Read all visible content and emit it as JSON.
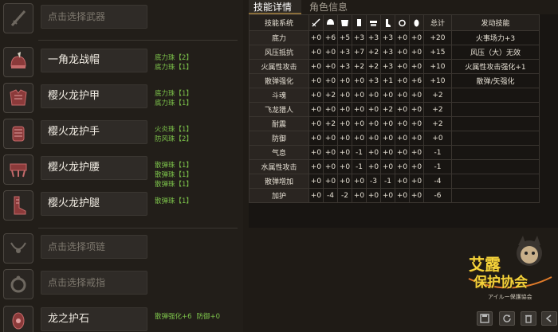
{
  "slots": [
    {
      "id": "weapon",
      "name": "点击选择武器",
      "empty": true,
      "jewels": []
    },
    {
      "id": "head",
      "name": "一角龙战帽",
      "empty": false,
      "jewels": [
        "底力珠【2】",
        "底力珠【1】"
      ]
    },
    {
      "id": "chest",
      "name": "樱火龙护甲",
      "empty": false,
      "jewels": [
        "底力珠【1】",
        "底力珠【1】"
      ]
    },
    {
      "id": "arms",
      "name": "樱火龙护手",
      "empty": false,
      "jewels": [
        "火炎珠【1】",
        "防风珠【2】"
      ]
    },
    {
      "id": "waist",
      "name": "樱火龙护腰",
      "empty": false,
      "jewels": [
        "散弹珠【1】",
        "散弹珠【1】",
        "散弹珠【1】"
      ]
    },
    {
      "id": "legs",
      "name": "樱火龙护腿",
      "empty": false,
      "jewels": [
        "散弹珠【1】"
      ]
    },
    {
      "id": "necklace",
      "name": "点击选择项链",
      "empty": true,
      "jewels": []
    },
    {
      "id": "ring",
      "name": "点击选择戒指",
      "empty": true,
      "jewels": []
    },
    {
      "id": "charm",
      "name": "龙之护石",
      "empty": false,
      "jewels": [
        "散弹强化+6",
        "防御+0"
      ]
    }
  ],
  "tabs": {
    "skills": "技能详情",
    "character": "角色信息"
  },
  "table": {
    "headers": {
      "skill": "技能系统",
      "total": "总计",
      "active": "发动技能"
    },
    "header_icons": [
      "weapon-icon",
      "sword-icon",
      "helmet-icon",
      "chest-icon",
      "arms-icon",
      "waist-icon",
      "legs-icon",
      "ring-icon",
      "charm-icon"
    ],
    "rows": [
      {
        "skill": "底力",
        "vals": [
          "+0",
          "+6",
          "+5",
          "+3",
          "+3",
          "+3",
          "+0",
          "+0"
        ],
        "total": "+20",
        "active": "火事场力+3"
      },
      {
        "skill": "风压抵抗",
        "vals": [
          "+0",
          "+0",
          "+3",
          "+7",
          "+2",
          "+3",
          "+0",
          "+0"
        ],
        "total": "+15",
        "active": "风压（大）无效"
      },
      {
        "skill": "火属性攻击",
        "vals": [
          "+0",
          "+0",
          "+3",
          "+2",
          "+2",
          "+3",
          "+0",
          "+0"
        ],
        "total": "+10",
        "active": "火属性攻击强化+1"
      },
      {
        "skill": "散弹强化",
        "vals": [
          "+0",
          "+0",
          "+0",
          "+0",
          "+3",
          "+1",
          "+0",
          "+6"
        ],
        "total": "+10",
        "active": "散弹/矢强化"
      },
      {
        "skill": "斗魂",
        "vals": [
          "+0",
          "+2",
          "+0",
          "+0",
          "+0",
          "+0",
          "+0",
          "+0"
        ],
        "total": "+2",
        "active": ""
      },
      {
        "skill": "飞龙猎人",
        "vals": [
          "+0",
          "+0",
          "+0",
          "+0",
          "+0",
          "+2",
          "+0",
          "+0"
        ],
        "total": "+2",
        "active": ""
      },
      {
        "skill": "耐震",
        "vals": [
          "+0",
          "+2",
          "+0",
          "+0",
          "+0",
          "+0",
          "+0",
          "+0"
        ],
        "total": "+2",
        "active": ""
      },
      {
        "skill": "防御",
        "vals": [
          "+0",
          "+0",
          "+0",
          "+0",
          "+0",
          "+0",
          "+0",
          "+0"
        ],
        "total": "+0",
        "active": ""
      },
      {
        "skill": "气息",
        "vals": [
          "+0",
          "+0",
          "+0",
          "-1",
          "+0",
          "+0",
          "+0",
          "+0"
        ],
        "total": "-1",
        "active": ""
      },
      {
        "skill": "水属性攻击",
        "vals": [
          "+0",
          "+0",
          "+0",
          "-1",
          "+0",
          "+0",
          "+0",
          "+0"
        ],
        "total": "-1",
        "active": ""
      },
      {
        "skill": "散弹增加",
        "vals": [
          "+0",
          "+0",
          "+0",
          "+0",
          "-3",
          "-1",
          "+0",
          "+0"
        ],
        "total": "-4",
        "active": ""
      },
      {
        "skill": "加护",
        "vals": [
          "+0",
          "-4",
          "-2",
          "+0",
          "+0",
          "+0",
          "+0",
          "+0"
        ],
        "total": "-6",
        "active": ""
      }
    ]
  },
  "logo": {
    "text": "艾露",
    "line2": "保护协会",
    "sub": "アイルー保護協会"
  },
  "bottom_buttons": [
    "save-icon",
    "refresh-icon",
    "delete-icon",
    "share-icon"
  ],
  "colors": {
    "jewel": "#7cc24a",
    "panel": "#221e19",
    "table_bg": "#181512"
  }
}
